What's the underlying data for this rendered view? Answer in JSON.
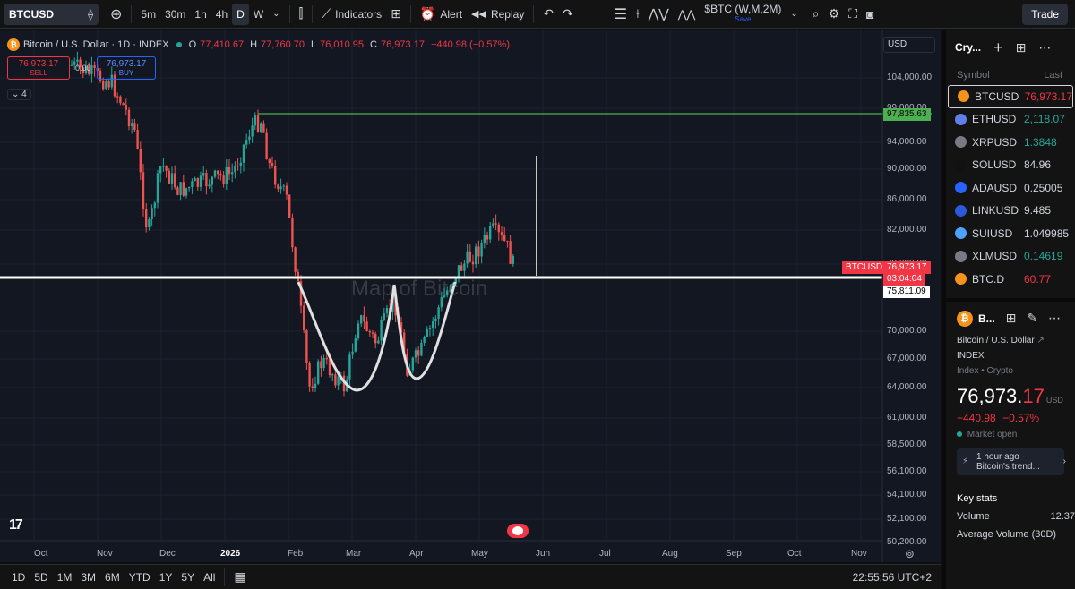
{
  "toolbar": {
    "symbol": "BTCUSD",
    "intervals": [
      "5m",
      "30m",
      "1h",
      "4h",
      "D",
      "W"
    ],
    "active_interval": "D",
    "indicators_label": "Indicators",
    "alert_label": "Alert",
    "replay_label": "Replay",
    "compare_symbol": "$BTC (W,M,2M)",
    "compare_sub": "Save",
    "trade_label": "Trade"
  },
  "chart": {
    "legend_title": "Bitcoin / U.S. Dollar · 1D · INDEX",
    "ohlc": [
      {
        "label": "O",
        "value": "77,410.67"
      },
      {
        "label": "H",
        "value": "77,760.70"
      },
      {
        "label": "L",
        "value": "76,010.95"
      },
      {
        "label": "C",
        "value": "76,973.17"
      }
    ],
    "change": "−440.98 (−0.57%)",
    "sell_price": "76,973.17",
    "sell_label": "SELL",
    "buy_price": "76,973.17",
    "buy_label": "BUY",
    "spread": "0.00",
    "indicator_count": "4",
    "currency": "USD",
    "watermark": "Map of Bitcoin",
    "tv_logo": "17",
    "price_ticks": [
      "104,000.00",
      "99,000.00",
      "94,000.00",
      "90,000.00",
      "86,000.00",
      "82,000.00",
      "78,000.00",
      "70,000.00",
      "67,000.00",
      "64,000.00",
      "61,000.00",
      "58,500.00",
      "56,100.00",
      "54,100.00",
      "52,100.00",
      "50,200.00"
    ],
    "time_ticks": [
      "Oct",
      "Nov",
      "Dec",
      "2026",
      "Feb",
      "Mar",
      "Apr",
      "May",
      "Jun",
      "Jul",
      "Aug",
      "Sep",
      "Oct",
      "Nov"
    ],
    "resistance_label": "97,835.63",
    "current_symbol_tag": "BTCUSD",
    "current_price_tag": "76,973.17",
    "countdown_tag": "03:04:04",
    "neckline_tag": "75,811.09"
  },
  "bottombar": {
    "ranges": [
      "1D",
      "5D",
      "1M",
      "3M",
      "6M",
      "YTD",
      "1Y",
      "5Y",
      "All"
    ],
    "clock": "22:55:56 UTC+2"
  },
  "watchlist": {
    "title": "Cry...",
    "col_symbol": "Symbol",
    "col_last": "Last",
    "rows": [
      {
        "symbol": "BTCUSD",
        "last": "76,973.17",
        "color": "#f7931a",
        "tone": "red",
        "selected": true
      },
      {
        "symbol": "ETHUSD",
        "last": "2,118.07",
        "color": "#627eea",
        "tone": "green"
      },
      {
        "symbol": "XRPUSD",
        "last": "1.3848",
        "color": "#787b86",
        "tone": "green"
      },
      {
        "symbol": "SOLUSD",
        "last": "84.96",
        "color": "#111111",
        "tone": "plain"
      },
      {
        "symbol": "ADAUSD",
        "last": "0.25005",
        "color": "#2962ff",
        "tone": "plain"
      },
      {
        "symbol": "LINKUSD",
        "last": "9.485",
        "color": "#2a5ada",
        "tone": "plain"
      },
      {
        "symbol": "SUIUSD",
        "last": "1.049985",
        "color": "#4da2ff",
        "tone": "plain"
      },
      {
        "symbol": "XLMUSD",
        "last": "0.14619",
        "color": "#787b86",
        "tone": "green"
      },
      {
        "symbol": "BTC.D",
        "last": "60.77",
        "color": "#f7931a",
        "tone": "red"
      }
    ]
  },
  "details": {
    "short_symbol": "B...",
    "name": "Bitcoin / U.S. Dollar",
    "exchange": "INDEX",
    "category": "Index • Crypto",
    "price_main": "76,973.",
    "price_decimals": "17",
    "price_currency": "USD",
    "change_abs": "−440.98",
    "change_pct": "−0.57%",
    "market_status": "Market open",
    "news_time": "1 hour ago ·",
    "news_title": "Bitcoin's trend...",
    "key_stats_label": "Key stats",
    "volume_label": "Volume",
    "volume_value": "12.37",
    "avg_volume_label": "Average Volume (30D)"
  }
}
